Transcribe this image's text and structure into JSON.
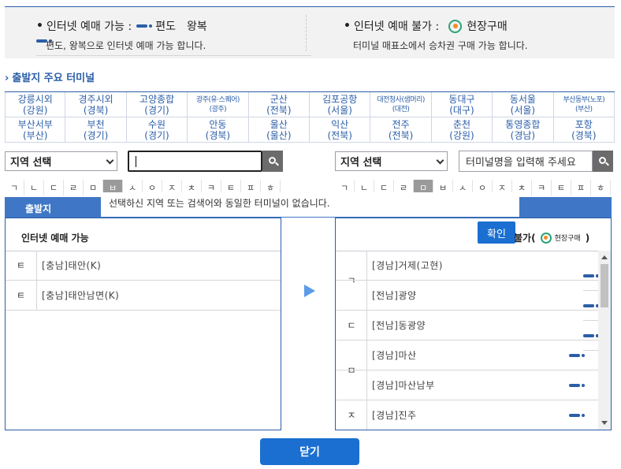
{
  "legend": {
    "left_title": "인터넷 예매 가능 :",
    "one_way": "편도",
    "round_trip": "왕복",
    "left_sub": "편도, 왕복으로 인터넷 예매 가능 합니다.",
    "right_title": "인터넷 예매 불가 :",
    "on_site": "현장구매",
    "right_sub": "터미널 매표소에서 승차권 구매 가능 합니다."
  },
  "major": {
    "title": "출발지 주요 터미널",
    "terminals": [
      {
        "label": "강릉시외\n(강원)",
        "small": false
      },
      {
        "label": "경주시외\n(경북)",
        "small": false
      },
      {
        "label": "고양종합\n(경기)",
        "small": false
      },
      {
        "label": "광주(유·스퀘어)\n(광주)",
        "small": true
      },
      {
        "label": "군산\n(전북)",
        "small": false
      },
      {
        "label": "김포공항\n(서울)",
        "small": false
      },
      {
        "label": "대전청사(샘머리)\n(대전)",
        "small": true
      },
      {
        "label": "동대구\n(대구)",
        "small": false
      },
      {
        "label": "동서울\n(서울)",
        "small": false
      },
      {
        "label": "부산동부(노포)\n(부산)",
        "small": true
      },
      {
        "label": "부산서부\n(부산)",
        "small": false
      },
      {
        "label": "부천\n(경기)",
        "small": false
      },
      {
        "label": "수원\n(경기)",
        "small": false
      },
      {
        "label": "안동\n(경북)",
        "small": false
      },
      {
        "label": "울산\n(울산)",
        "small": false
      },
      {
        "label": "익산\n(전북)",
        "small": false
      },
      {
        "label": "전주\n(전북)",
        "small": false
      },
      {
        "label": "춘천\n(강원)",
        "small": false
      },
      {
        "label": "통영종합\n(경남)",
        "small": false
      },
      {
        "label": "포항\n(경북)",
        "small": false
      }
    ]
  },
  "search": {
    "left_region": "지역 선택",
    "left_input": "",
    "right_region": "지역 선택",
    "right_placeholder": "터미널명을 입력해 주세요"
  },
  "consonants": [
    "ㄱ",
    "ㄴ",
    "ㄷ",
    "ㄹ",
    "ㅁ",
    "ㅂ",
    "ㅅ",
    "ㅇ",
    "ㅈ",
    "ㅊ",
    "ㅋ",
    "ㅌ",
    "ㅍ",
    "ㅎ"
  ],
  "tab": {
    "departure": "출발지"
  },
  "alert": {
    "message": "선택하신 지역 또는 검색어와 동일한 터미널이 없습니다.",
    "confirm": "확인"
  },
  "left_panel": {
    "header": "인터넷 예매 가능",
    "rows": [
      {
        "initial": "ㅌ",
        "region": "[충남]",
        "name": "태안(K)"
      },
      {
        "initial": "ㅌ",
        "region": "[충남]",
        "name": "태안남면(K)"
      }
    ]
  },
  "right_panel": {
    "header_suffix": "불가(",
    "header_icon_label": "현장구매",
    "header_close": ")",
    "initials": [
      {
        "label": "ㄱ",
        "span": 2
      },
      {
        "label": "ㄷ",
        "span": 1
      },
      {
        "label": "ㅁ",
        "span": 2
      },
      {
        "label": "ㅈ",
        "span": 1
      }
    ],
    "rows": [
      {
        "region": "[경남]",
        "name": "거제(고현)",
        "type": "round"
      },
      {
        "region": "[전남]",
        "name": "광양",
        "type": "round"
      },
      {
        "region": "[전남]",
        "name": "동광양",
        "type": "round"
      },
      {
        "region": "[경남]",
        "name": "마산",
        "type": "one"
      },
      {
        "region": "[경남]",
        "name": "마산남부",
        "type": "one"
      },
      {
        "region": "[경남]",
        "name": "진주",
        "type": "one"
      }
    ]
  },
  "footer": {
    "close": "닫기"
  }
}
